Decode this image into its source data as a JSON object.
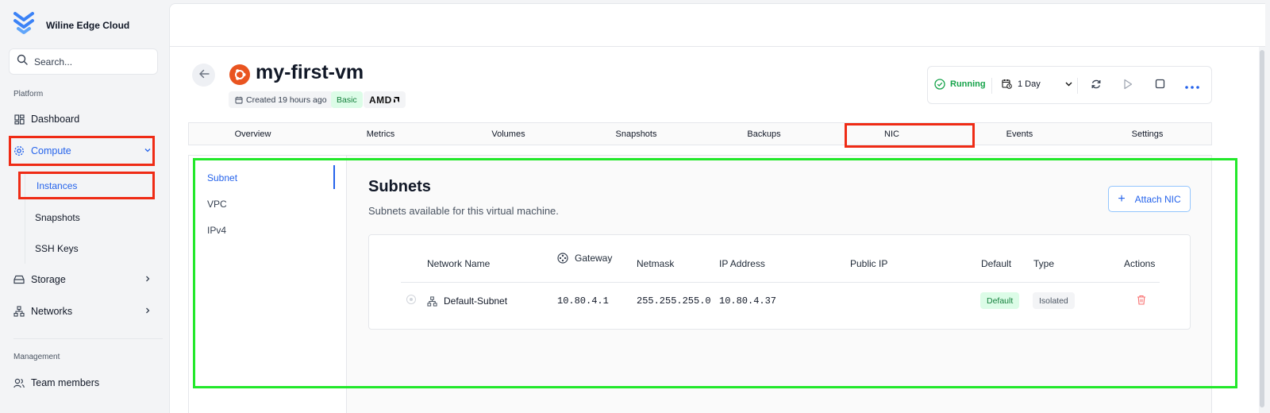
{
  "app": {
    "name": "Wiline Edge Cloud"
  },
  "search": {
    "placeholder": "Search..."
  },
  "sidebar": {
    "platform_label": "Platform",
    "management_label": "Management",
    "items": [
      {
        "label": "Dashboard",
        "icon": "dashboard-icon"
      },
      {
        "label": "Compute",
        "icon": "gear-icon",
        "expanded": true
      },
      {
        "label": "Storage",
        "icon": "storage-icon"
      },
      {
        "label": "Networks",
        "icon": "network-icon"
      },
      {
        "label": "Team members",
        "icon": "users-icon"
      }
    ],
    "compute_sub": [
      {
        "label": "Instances",
        "active": true
      },
      {
        "label": "Snapshots"
      },
      {
        "label": "SSH Keys"
      }
    ]
  },
  "vm": {
    "name": "my-first-vm",
    "created": "Created 19 hours ago",
    "plan": "Basic",
    "cpu_vendor": "AMD"
  },
  "actions": {
    "status": "Running",
    "range": "1 Day"
  },
  "tabs": [
    "Overview",
    "Metrics",
    "Volumes",
    "Snapshots",
    "Backups",
    "NIC",
    "Events",
    "Settings"
  ],
  "nic_nav": [
    "Subnet",
    "VPC",
    "IPv4"
  ],
  "subnets": {
    "title": "Subnets",
    "description": "Subnets available for this virtual machine.",
    "attach_label": "Attach NIC",
    "columns": {
      "network_name": "Network Name",
      "gateway": "Gateway",
      "netmask": "Netmask",
      "ip_address": "IP Address",
      "public_ip": "Public IP",
      "default": "Default",
      "type": "Type",
      "actions": "Actions"
    },
    "rows": [
      {
        "network_name": "Default-Subnet",
        "gateway": "10.80.4.1",
        "netmask": "255.255.255.0",
        "ip_address": "10.80.4.37",
        "public_ip": "",
        "default": "Default",
        "type": "Isolated"
      }
    ]
  },
  "colors": {
    "accent": "#2563eb",
    "running": "#16a34a",
    "highlight_red": "#ef2b15",
    "highlight_green": "#22e82a",
    "ubuntu": "#e95420"
  }
}
